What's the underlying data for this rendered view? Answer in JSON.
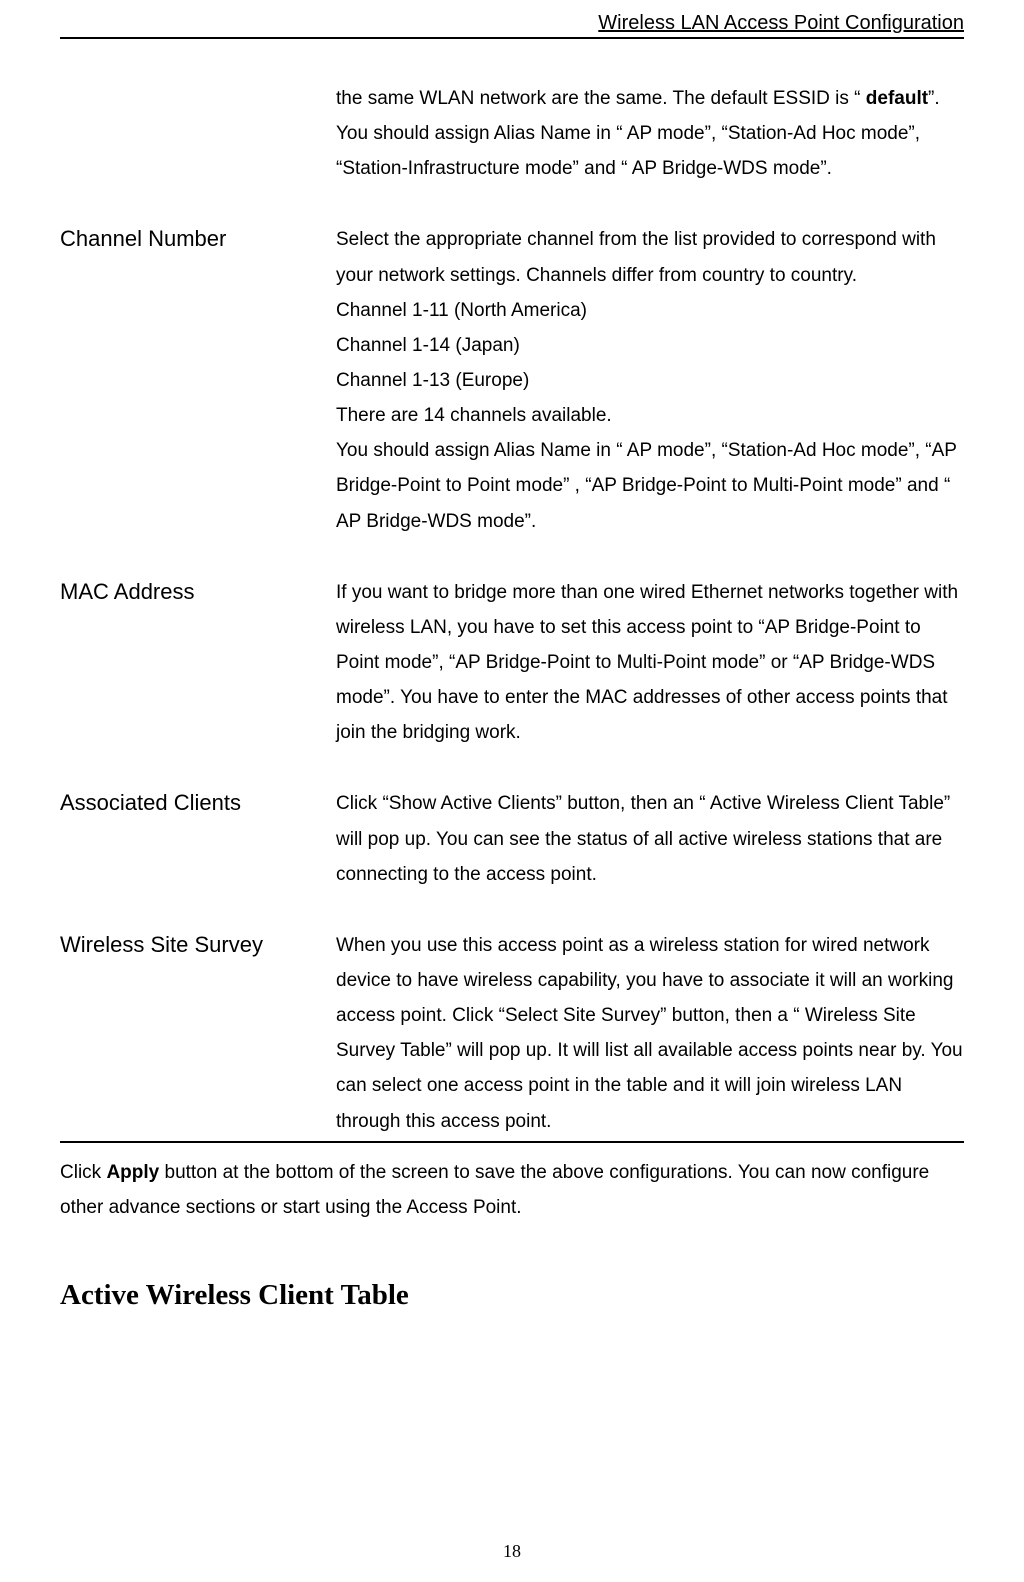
{
  "header": {
    "title": "Wireless LAN Access Point Configuration"
  },
  "rows": [
    {
      "label": "",
      "desc_before": "the same WLAN network are the same. The default ESSID is “ ",
      "desc_bold": "default",
      "desc_after": "”. You should assign Alias Name in “ AP mode”, “Station-Ad Hoc mode”, “Station-Infrastructure mode” and “ AP Bridge-WDS mode”."
    },
    {
      "label": "Channel Number",
      "desc": "Select the appropriate channel from the list provided to correspond with your network settings. Channels differ from country to country.\nChannel 1-11 (North America)\nChannel 1-14 (Japan)\nChannel 1-13 (Europe)\nThere are 14 channels available.\nYou should assign Alias Name in “ AP mode”, “Station-Ad Hoc mode”, “AP Bridge-Point to Point mode” , “AP Bridge-Point to Multi-Point mode” and “ AP Bridge-WDS mode”."
    },
    {
      "label": "MAC Address",
      "desc": "If you want to bridge more than one wired Ethernet networks together with wireless LAN, you have to set this access point to “AP Bridge-Point to Point mode”, “AP Bridge-Point to Multi-Point mode” or “AP Bridge-WDS mode”. You have to enter the MAC addresses of other access points that join the bridging work."
    },
    {
      "label": "Associated Clients",
      "desc": "Click “Show Active Clients” button, then an “ Active Wireless Client Table” will pop up. You can see the status of all active wireless stations that are connecting to the access point."
    },
    {
      "label": "Wireless Site Survey",
      "desc": "When you use this access point as a wireless station for wired network device to have wireless capability, you have to associate it will an working access point. Click “Select Site Survey” button, then a “ Wireless Site Survey Table” will pop up. It will list all available access points near by. You can select one access point in the table and it will join wireless LAN through this access point."
    }
  ],
  "footer": {
    "before": "Click ",
    "bold": "Apply",
    "after": " button at the bottom of the screen to save the above configurations. You can now configure other advance sections or start using the Access Point."
  },
  "section_heading": "Active Wireless Client Table",
  "page_number": "18"
}
